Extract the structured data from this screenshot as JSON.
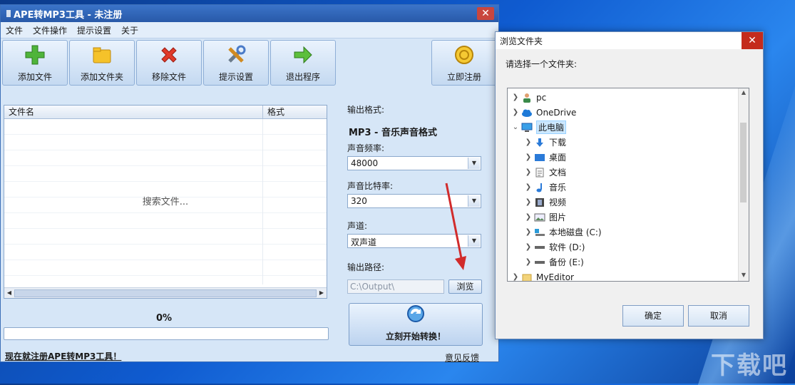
{
  "main_window": {
    "title": "APE转MP3工具 - 未注册",
    "title_icon": "app-icon",
    "close_glyph": "✕",
    "menu": [
      "文件",
      "文件操作",
      "提示设置",
      "关于"
    ],
    "toolbar": [
      {
        "label": "添加文件",
        "icon": "add-icon"
      },
      {
        "label": "添加文件夹",
        "icon": "folder-icon"
      },
      {
        "label": "移除文件",
        "icon": "remove-icon"
      },
      {
        "label": "提示设置",
        "icon": "tools-icon"
      },
      {
        "label": "退出程序",
        "icon": "exit-arrow-icon"
      }
    ],
    "register_button": {
      "label": "立即注册",
      "icon": "coin-icon"
    },
    "file_list": {
      "columns": [
        "文件名",
        "格式"
      ],
      "empty_text": "搜索文件..."
    },
    "progress": {
      "label": "0%",
      "value": 0
    },
    "register_link": "现在就注册APE转MP3工具！",
    "feedback_link": "意见反馈",
    "settings": {
      "format_label": "输出格式:",
      "format_value": "MP3 - 音乐声音格式",
      "frequency_label": "声音频率:",
      "frequency_value": "48000",
      "bitrate_label": "声音比特率:",
      "bitrate_value": "320",
      "channel_label": "声道:",
      "channel_value": "双声道",
      "output_label": "输出路径:",
      "output_value": "C:\\Output\\",
      "browse_label": "浏览",
      "start_label": "立刻开始转换！"
    }
  },
  "dialog": {
    "title": "浏览文件夹",
    "close_glyph": "✕",
    "prompt": "请选择一个文件夹:",
    "tree": [
      {
        "label": "pc",
        "icon": "user-icon",
        "level": 0,
        "expanded": false
      },
      {
        "label": "OneDrive",
        "icon": "cloud-icon",
        "level": 0,
        "expanded": false
      },
      {
        "label": "此电脑",
        "icon": "computer-icon",
        "level": 0,
        "expanded": true,
        "selected": true
      },
      {
        "label": "下载",
        "icon": "download-icon",
        "level": 1,
        "expanded": false
      },
      {
        "label": "桌面",
        "icon": "desktop-icon",
        "level": 1,
        "expanded": false
      },
      {
        "label": "文档",
        "icon": "document-icon",
        "level": 1,
        "expanded": false
      },
      {
        "label": "音乐",
        "icon": "music-icon",
        "level": 1,
        "expanded": false
      },
      {
        "label": "视频",
        "icon": "video-icon",
        "level": 1,
        "expanded": false
      },
      {
        "label": "图片",
        "icon": "picture-icon",
        "level": 1,
        "expanded": false
      },
      {
        "label": "本地磁盘 (C:)",
        "icon": "drive-c-icon",
        "level": 1,
        "expanded": false
      },
      {
        "label": "软件 (D:)",
        "icon": "drive-icon",
        "level": 1,
        "expanded": false
      },
      {
        "label": "备份 (E:)",
        "icon": "drive-icon",
        "level": 1,
        "expanded": false
      },
      {
        "label": "MyEditor",
        "icon": "folder-icon",
        "level": 0,
        "expanded": false
      }
    ],
    "ok_label": "确定",
    "cancel_label": "取消"
  },
  "watermark": "下载吧",
  "colors": {
    "accent_red": "#d12b2b",
    "window_bg": "#d6e6f7",
    "title_blue": "#2f65b8"
  }
}
